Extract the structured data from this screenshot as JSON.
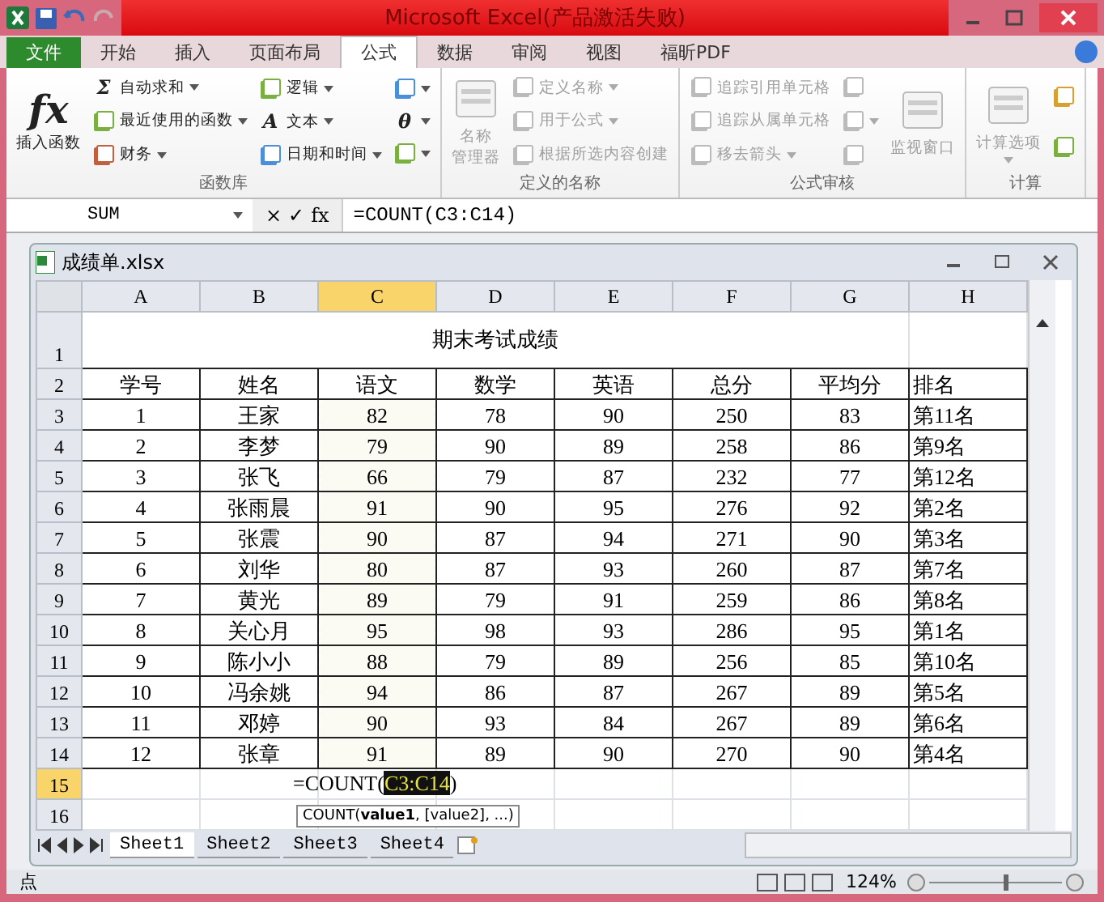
{
  "window": {
    "title": "Microsoft Excel(产品激活失败)"
  },
  "tabs": [
    {
      "label": "文件",
      "kind": "file",
      "selected": false
    },
    {
      "label": "开始",
      "kind": "tab",
      "selected": false
    },
    {
      "label": "插入",
      "kind": "tab",
      "selected": false
    },
    {
      "label": "页面布局",
      "kind": "tab",
      "selected": false
    },
    {
      "label": "公式",
      "kind": "tab",
      "selected": true
    },
    {
      "label": "数据",
      "kind": "tab",
      "selected": false
    },
    {
      "label": "审阅",
      "kind": "tab",
      "selected": false
    },
    {
      "label": "视图",
      "kind": "tab",
      "selected": false
    },
    {
      "label": "福昕PDF",
      "kind": "tab",
      "selected": false
    }
  ],
  "ribbon": {
    "groups": [
      {
        "label": "函数库",
        "columns": [
          [
            {
              "kind": "large",
              "glyph": "fx",
              "label": "插入函数",
              "disabled": false,
              "dropdown": false
            }
          ],
          [
            {
              "kind": "small",
              "glyph": "Σ",
              "label": "自动求和",
              "disabled": false,
              "dropdown": true
            },
            {
              "kind": "small",
              "label": "最近使用的函数",
              "disabled": false,
              "dropdown": true
            },
            {
              "kind": "small",
              "label": "财务",
              "disabled": false,
              "dropdown": true
            }
          ],
          [
            {
              "kind": "small",
              "label": "逻辑",
              "disabled": false,
              "dropdown": true
            },
            {
              "kind": "small",
              "glyph": "A",
              "label": "文本",
              "disabled": false,
              "dropdown": true
            },
            {
              "kind": "small",
              "label": "日期和时间",
              "disabled": false,
              "dropdown": true
            }
          ],
          [
            {
              "kind": "icon",
              "disabled": false,
              "dropdown": true
            },
            {
              "kind": "icon",
              "glyph": "θ",
              "disabled": false,
              "dropdown": true
            },
            {
              "kind": "icon",
              "disabled": false,
              "dropdown": true
            }
          ]
        ]
      },
      {
        "label": "定义的名称",
        "columns": [
          [
            {
              "kind": "large",
              "label_lines": [
                "名称",
                "管理器"
              ],
              "disabled": true,
              "dropdown": false
            }
          ],
          [
            {
              "kind": "small",
              "label": "定义名称",
              "disabled": true,
              "dropdown": true
            },
            {
              "kind": "small",
              "label": "用于公式",
              "disabled": true,
              "dropdown": true
            },
            {
              "kind": "small",
              "label": "根据所选内容创建",
              "disabled": true,
              "dropdown": false
            }
          ]
        ]
      },
      {
        "label": "公式审核",
        "columns": [
          [
            {
              "kind": "small",
              "label": "追踪引用单元格",
              "disabled": true,
              "dropdown": false
            },
            {
              "kind": "small",
              "label": "追踪从属单元格",
              "disabled": true,
              "dropdown": false
            },
            {
              "kind": "small",
              "label": "移去箭头",
              "disabled": true,
              "dropdown": true
            }
          ],
          [
            {
              "kind": "icon",
              "disabled": true,
              "dropdown": false
            },
            {
              "kind": "icon",
              "disabled": true,
              "dropdown": true
            },
            {
              "kind": "icon",
              "disabled": true,
              "dropdown": false
            }
          ],
          [
            {
              "kind": "large",
              "label": "监视窗口",
              "disabled": true,
              "dropdown": false
            }
          ]
        ]
      },
      {
        "label": "计算",
        "columns": [
          [
            {
              "kind": "large",
              "label": "计算选项",
              "disabled": true,
              "dropdown": true
            }
          ],
          [
            {
              "kind": "icon",
              "disabled": false,
              "dropdown": false
            },
            {
              "kind": "icon",
              "disabled": false,
              "dropdown": false
            }
          ]
        ]
      }
    ]
  },
  "formula_bar": {
    "name_box": "SUM",
    "buttons": [
      "×",
      "✓",
      "fx"
    ],
    "formula": "=COUNT(C3:C14)"
  },
  "workbook": {
    "title": "成绩单.xlsx",
    "columns": [
      {
        "label": "A",
        "selected": false,
        "referenced": false
      },
      {
        "label": "B",
        "selected": false,
        "referenced": false
      },
      {
        "label": "C",
        "selected": true,
        "referenced": true
      },
      {
        "label": "D",
        "selected": false,
        "referenced": false
      },
      {
        "label": "E",
        "selected": false,
        "referenced": false
      },
      {
        "label": "F",
        "selected": false,
        "referenced": false
      },
      {
        "label": "G",
        "selected": false,
        "referenced": false
      },
      {
        "label": "H",
        "selected": false,
        "referenced": false
      }
    ],
    "rows": [
      {
        "label": "1",
        "kind": "title",
        "selected": false,
        "cells": [
          "期末考试成绩"
        ]
      },
      {
        "label": "2",
        "kind": "data",
        "selected": false,
        "cells": [
          "学号",
          "姓名",
          "语文",
          "数学",
          "英语",
          "总分",
          "平均分",
          "排名"
        ]
      },
      {
        "label": "3",
        "kind": "data",
        "selected": false,
        "referenced": true,
        "cells": [
          "1",
          "王家",
          "82",
          "78",
          "90",
          "250",
          "83",
          "第11名"
        ]
      },
      {
        "label": "4",
        "kind": "data",
        "selected": false,
        "referenced": true,
        "cells": [
          "2",
          "李梦",
          "79",
          "90",
          "89",
          "258",
          "86",
          "第9名"
        ]
      },
      {
        "label": "5",
        "kind": "data",
        "selected": false,
        "referenced": true,
        "cells": [
          "3",
          "张飞",
          "66",
          "79",
          "87",
          "232",
          "77",
          "第12名"
        ]
      },
      {
        "label": "6",
        "kind": "data",
        "selected": false,
        "referenced": true,
        "cells": [
          "4",
          "张雨晨",
          "91",
          "90",
          "95",
          "276",
          "92",
          "第2名"
        ]
      },
      {
        "label": "7",
        "kind": "data",
        "selected": false,
        "referenced": true,
        "cells": [
          "5",
          "张震",
          "90",
          "87",
          "94",
          "271",
          "90",
          "第3名"
        ]
      },
      {
        "label": "8",
        "kind": "data",
        "selected": false,
        "referenced": true,
        "cells": [
          "6",
          "刘华",
          "80",
          "87",
          "93",
          "260",
          "87",
          "第7名"
        ]
      },
      {
        "label": "9",
        "kind": "data",
        "selected": false,
        "referenced": true,
        "cells": [
          "7",
          "黄光",
          "89",
          "79",
          "91",
          "259",
          "86",
          "第8名"
        ]
      },
      {
        "label": "10",
        "kind": "data",
        "selected": false,
        "referenced": true,
        "cells": [
          "8",
          "关心月",
          "95",
          "98",
          "93",
          "286",
          "95",
          "第1名"
        ]
      },
      {
        "label": "11",
        "kind": "data",
        "selected": false,
        "referenced": true,
        "cells": [
          "9",
          "陈小小",
          "88",
          "79",
          "89",
          "256",
          "85",
          "第10名"
        ]
      },
      {
        "label": "12",
        "kind": "data",
        "selected": false,
        "referenced": true,
        "cells": [
          "10",
          "冯余姚",
          "94",
          "86",
          "87",
          "267",
          "89",
          "第5名"
        ]
      },
      {
        "label": "13",
        "kind": "data",
        "selected": false,
        "referenced": true,
        "cells": [
          "11",
          "邓婷",
          "90",
          "93",
          "84",
          "267",
          "89",
          "第6名"
        ]
      },
      {
        "label": "14",
        "kind": "data",
        "selected": false,
        "referenced": true,
        "cells": [
          "12",
          "张章",
          "91",
          "89",
          "90",
          "270",
          "90",
          "第4名"
        ]
      },
      {
        "label": "15",
        "kind": "formula",
        "selected": true,
        "formula": {
          "before": "=COUNT(",
          "ref": "C3:C14",
          "after": ")"
        },
        "tooltip": "COUNT(**value1**, [value2], ...)"
      },
      {
        "label": "16",
        "kind": "empty",
        "selected": false
      }
    ],
    "sheets": [
      {
        "label": "Sheet1",
        "selected": true
      },
      {
        "label": "Sheet2",
        "selected": false
      },
      {
        "label": "Sheet3",
        "selected": false
      },
      {
        "label": "Sheet4",
        "selected": false
      }
    ]
  },
  "status_bar": {
    "mode": "点",
    "zoom": "124%"
  }
}
